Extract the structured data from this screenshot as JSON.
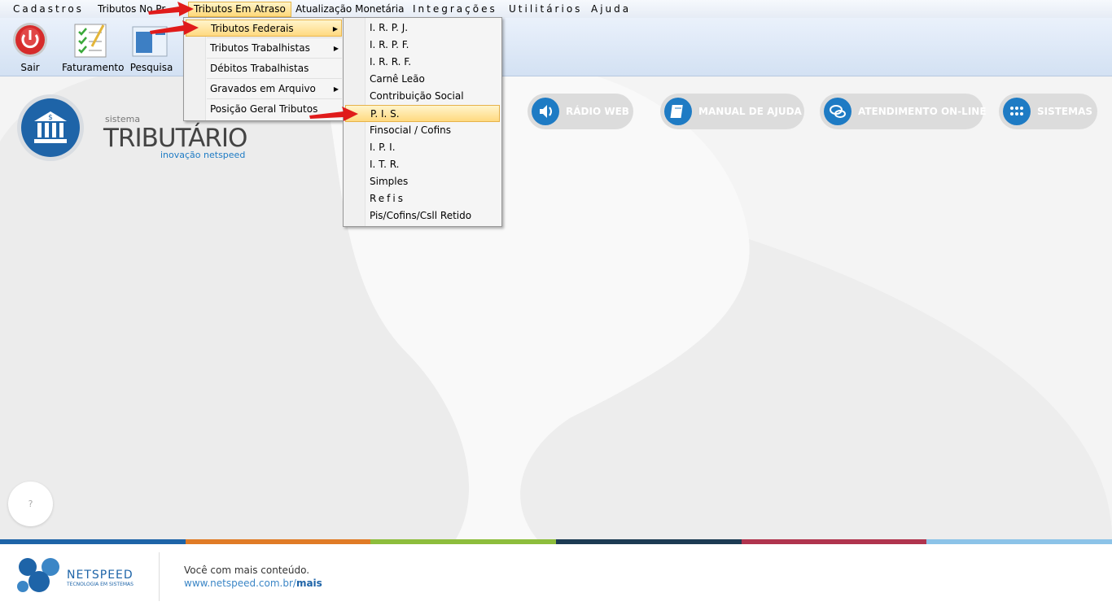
{
  "menubar": {
    "items": [
      {
        "label": "Cadastros"
      },
      {
        "label": "Tributos No Pr"
      },
      {
        "label": "Tributos Em Atraso"
      },
      {
        "label": "Atualização Monetária"
      },
      {
        "label": "Integrações"
      },
      {
        "label": "Utilitários"
      },
      {
        "label": "Ajuda"
      }
    ]
  },
  "toolbar": {
    "buttons": [
      {
        "label": "Sair",
        "icon": "power-icon"
      },
      {
        "label": "Faturamento",
        "icon": "checklist-icon"
      },
      {
        "label": "Pesquisa",
        "icon": "search-icon"
      }
    ]
  },
  "branding": {
    "small": "sistema",
    "title": "TRIBUTÁRIO",
    "subtitle": "inovação netspeed"
  },
  "quick_links": [
    {
      "label": "RÁDIO WEB",
      "icon": "speaker-icon"
    },
    {
      "label": "MANUAL DE AJUDA",
      "icon": "book-icon"
    },
    {
      "label": "ATENDIMENTO ON-LINE",
      "icon": "chat-icon"
    },
    {
      "label": "SISTEMAS",
      "icon": "grid-icon"
    }
  ],
  "help_bubble": "?",
  "menu_atraso": {
    "items": [
      {
        "label": "Tributos Federais",
        "submenu": true,
        "highlighted": true
      },
      {
        "label": "Tributos Trabalhistas",
        "submenu": true
      },
      {
        "label": "Débitos Trabalhistas",
        "submenu": false
      },
      {
        "label": "Gravados em Arquivo",
        "submenu": true
      },
      {
        "label": "Posição Geral Tributos",
        "submenu": false
      }
    ]
  },
  "menu_federais": {
    "items": [
      {
        "label": "I. R. P. J."
      },
      {
        "label": "I. R. P. F."
      },
      {
        "label": "I. R. R. F."
      },
      {
        "label": "Carnê Leão"
      },
      {
        "label": "Contribuição Social"
      },
      {
        "label": "P. I. S.",
        "highlighted": true
      },
      {
        "label": "Finsocial / Cofins"
      },
      {
        "label": "I. P. I."
      },
      {
        "label": "I. T. R."
      },
      {
        "label": "Simples"
      },
      {
        "label": "Refis"
      },
      {
        "label": "Pis/Cofins/Csll Retido"
      }
    ]
  },
  "footer": {
    "brand": "NETSPEED",
    "brand_tagline": "TECNOLOGIA EM SISTEMAS",
    "text1": "Você com mais conteúdo.",
    "link_prefix": "www.netspeed.com.br/",
    "link_bold": "mais"
  },
  "colors": {
    "accent_blue": "#1e64a8",
    "highlight": "#ffd980",
    "footer_bar": [
      "#1e64a8",
      "#e07b26",
      "#8dbd3c",
      "#1c3b53",
      "#b0344e",
      "#8cc3e8"
    ]
  }
}
